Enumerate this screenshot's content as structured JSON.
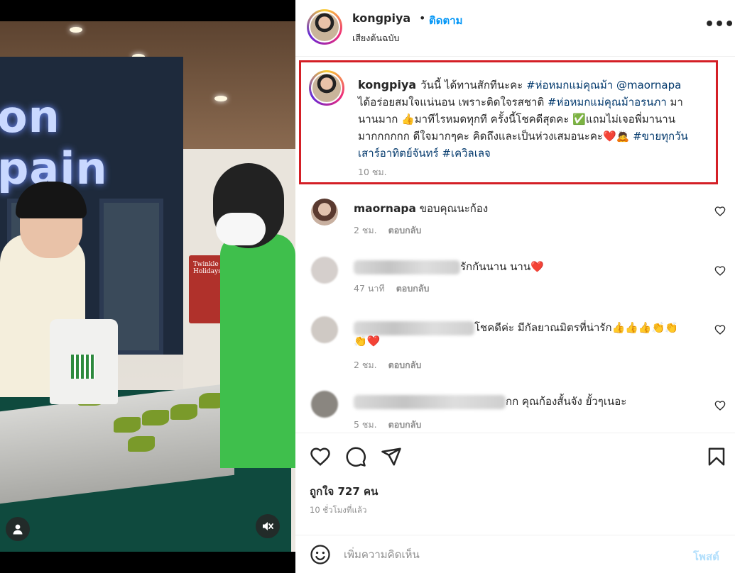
{
  "post_header": {
    "username": "kongpiya",
    "separator": "•",
    "follow_label": "ติดตาม",
    "audio_label": "เสียงต้นฉบับ",
    "more_label": "•••"
  },
  "caption": {
    "username": "kongpiya",
    "line1_text": "วันนี้ ได้ทานสักทีนะคะ ",
    "line1_tag": "#ห่อหมกแม่คุณม้า",
    "line1_mention": "@maornapa",
    "line2_text": "ได้อร่อยสมใจแน่นอน เพราะติดใจรสชาติ ",
    "line2_tag": "#ห่อหมกแม่คุณม้าอรนภา",
    "line2_rest": " มา",
    "line3_text": "นานมาก 👍มาทีไรหมดทุกที ครั้งนี้โชคดีสุดคะ ✅แถมไม่เจอพี่มานาน",
    "line4_text": "มากกกกกก ดีใจมากๆคะ คิดถึงและเป็นห่วงเสมอนะคะ❤️🙇 ",
    "line4_tag": "#ขายทุกวัน",
    "line5_tag": "เสาร์อาทิตย์จันทร์",
    "line5_tag2": "#เควิลเลจ",
    "time": "10 ชม."
  },
  "comments": [
    {
      "username": "maornapa",
      "text": "ขอบคุณนะก้อง",
      "time": "2 ชม.",
      "reply": "ตอบกลับ"
    },
    {
      "text": "รักกันนาน นาน❤️",
      "time": "47 นาที",
      "reply": "ตอบกลับ"
    },
    {
      "text": "โชคดีค่ะ มีกัลยาณมิตรที่น่ารัก👍👍👍👏👏",
      "text2": "👏❤️",
      "time": "2 ชม.",
      "reply": "ตอบกลับ"
    },
    {
      "text": "กก คุณก้องสั้นจัง ยั้วๆเนอะ",
      "time": "5 ชม.",
      "reply": "ตอบกลับ"
    }
  ],
  "engagement": {
    "likes": "ถูกใจ 727 คน",
    "posted": "10 ชั่วโมงที่แล้ว"
  },
  "composer": {
    "placeholder": "เพิ่มความคิดเห็น",
    "post_label": "โพสต์"
  },
  "media": {
    "sign_text": "on pain",
    "poster_text": "Twinkle Holidays"
  },
  "colors": {
    "accent": "#0095f6",
    "hashtag": "#00376b",
    "highlight_border": "#d41f26",
    "muted": "#8e8e8e"
  }
}
